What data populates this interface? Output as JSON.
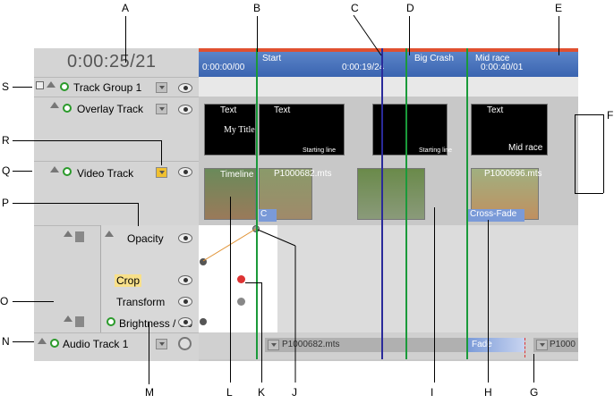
{
  "timecode": "0:00:25/21",
  "ruler": {
    "t0": "0:00:00/00",
    "t1": "0:00:19/24",
    "t2": "0:00:40/01"
  },
  "markers": [
    "Start",
    "Big Crash",
    "Mid race"
  ],
  "tracks": {
    "group": "Track Group 1",
    "overlay": "Overlay Track",
    "video": "Video Track",
    "opacity": "Opacity",
    "crop": "Crop",
    "transform": "Transform",
    "brightness": "Brightness / Co",
    "audio": "Audio Track 1"
  },
  "clips": {
    "text1": "Text",
    "title1": "My Title",
    "text2": "Text",
    "startline": "Starting line",
    "startline2": "Starting line",
    "text3": "Text",
    "midrace": "Mid race",
    "timeline": "Timeline",
    "p682": "P1000682.mts",
    "p696": "P1000696.mts",
    "crossfade": "Cross-Fade",
    "cross_short": "C",
    "audio_clip": "P1000682.mts",
    "fade": "Fade",
    "audio_clip2": "P1000"
  },
  "callouts": {
    "top": [
      "A",
      "B",
      "C",
      "D",
      "E"
    ],
    "left": [
      "S",
      "R",
      "Q",
      "P",
      "O",
      "N"
    ],
    "right": [
      "F"
    ],
    "bottom": [
      "M",
      "L",
      "K",
      "J",
      "I",
      "H",
      "G"
    ]
  }
}
